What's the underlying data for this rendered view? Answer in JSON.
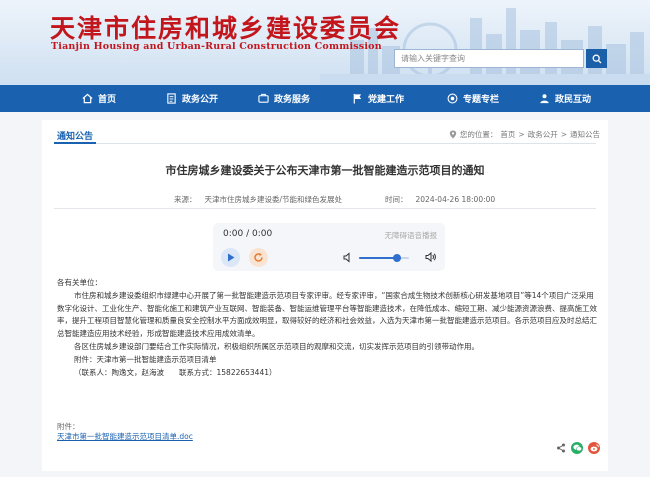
{
  "header": {
    "title": "天津市住房和城乡建设委员会",
    "subtitle": "Tianjin Housing and Urban-Rural Construction Commission",
    "search_placeholder": "请输入关键字查询"
  },
  "nav": {
    "items": [
      {
        "label": "首页",
        "icon": "home-icon"
      },
      {
        "label": "政务公开",
        "icon": "document-icon"
      },
      {
        "label": "政务服务",
        "icon": "service-icon"
      },
      {
        "label": "党建工作",
        "icon": "flag-icon"
      },
      {
        "label": "专题专栏",
        "icon": "target-icon"
      },
      {
        "label": "政民互动",
        "icon": "people-icon"
      }
    ]
  },
  "section": {
    "title": "通知公告",
    "breadcrumb": {
      "prefix": "您的位置：",
      "items": [
        "首页",
        "政务公开",
        "通知公告"
      ],
      "sep": ">"
    }
  },
  "article": {
    "title": "市住房城乡建设委关于公布天津市第一批智能建造示范项目的通知",
    "source_label": "来源：",
    "source": "天津市住房城乡建设委/节能和绿色发展处",
    "time_label": "时间：",
    "time": "2024-04-26 18:00:00",
    "greeting": "各有关单位：",
    "para1": "市住房和城乡建设委组织市绿建中心开展了第一批智能建造示范项目专家评审。经专家评审，“国家合成生物技术创新核心研发基地项目”等14个项目广泛采用数字化设计、工业化生产、智能化施工和建筑产业互联网、智能装备、智能运维管理平台等智能建造技术，在降低成本、缩短工期、减少能源资源浪费、提高施工效率，提升工程项目智慧化管理和质量良安全控制水平方面成效明显，取得较好的经济和社会效益，入选为天津市第一批智能建造示范项目。各示范项目应及时总结汇总智能建造应用技术经验，形成智能建造技术应用成效清单。",
    "para2": "各区住房城乡建设部门要结合工作实际情况，积极组织所属区示范项目的观摩和交流，切实发挥示范项目的引领带动作用。",
    "enclosure": "附件：天津市第一批智能建造示范项目清单",
    "contact": "（联系人：陶逸文，赵海波　　联系方式：15822653441）",
    "attachment_label": "附件：",
    "attachment_file": "天津市第一批智能建造示范项目清单.doc"
  },
  "player": {
    "time_display": "0:00 / 0:00",
    "powered_by": "无障碍语音播报",
    "volume": 0.75
  },
  "colors": {
    "brand_red": "#c3161c",
    "nav_blue": "#1a62b0",
    "accent_blue": "#2f6fce"
  }
}
